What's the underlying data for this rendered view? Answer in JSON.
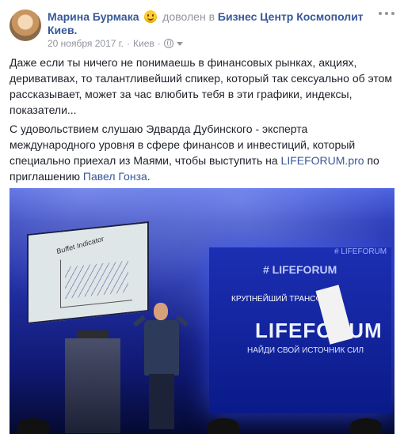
{
  "post": {
    "author": "Марина Бурмака",
    "feeling": "доволен в",
    "place_line1": "Бизнес Центр Космополит",
    "place_line2": "Киев.",
    "date": "20 ноября 2017 г.",
    "location": "Киев",
    "separator": "·",
    "paragraph1": "Даже если ты ничего не понимаешь в финансовых рынках, акциях, деривативах, то талантливейший спикер, который так сексуально об этом рассказывает, может за час влюбить тебя в эти графики, индексы, показатели...",
    "paragraph2_a": "С удовольствием слушаю Эдварда Дубинского - эксперта международного уровня в сфере финансов и инвестиций, который специально приехал из Маями, чтобы выступить на ",
    "paragraph2_link": "LIFEFORUM.pro",
    "paragraph2_b": " по приглашению ",
    "paragraph2_mention": "Павел Гонза",
    "paragraph2_end": "."
  },
  "photo": {
    "screen_title": "Buffet Indicator",
    "banner_logo": "LIFEFORUM",
    "banner_tag": "КРУПНЕЙШИЙ ТРАНСФОР",
    "banner_tag_mid": "# LIFEFORUM",
    "banner_top": "# LIFEFORUM",
    "banner_tagline": "НАЙДИ СВОЙ ИСТОЧНИК СИЛ"
  },
  "icons": {
    "emoji": "smiling-face-icon",
    "privacy": "globe-icon",
    "audience": "caret-down-icon",
    "more": "more-options-icon"
  }
}
